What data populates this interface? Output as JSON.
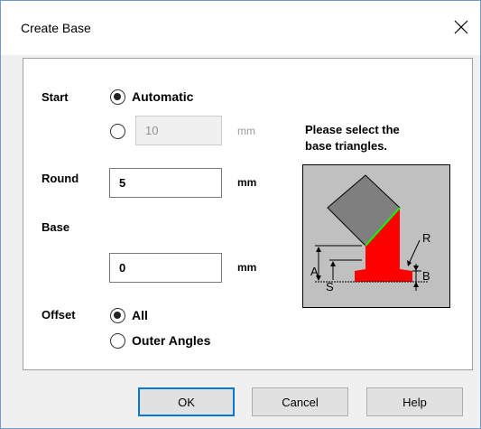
{
  "dialog": {
    "title": "Create Base"
  },
  "start": {
    "label": "Start",
    "option_automatic": "Automatic",
    "value": "10",
    "unit": "mm",
    "selected": "Automatic"
  },
  "round": {
    "label": "Round",
    "value": "5",
    "unit": "mm"
  },
  "base": {
    "label": "Base",
    "value": "0",
    "unit": "mm"
  },
  "offset": {
    "label": "Offset",
    "option_all": "All",
    "option_outer": "Outer Angles",
    "selected": "All"
  },
  "hint": {
    "line1": "Please select the",
    "line2": "base triangles."
  },
  "diagram": {
    "labels": {
      "r": "R",
      "a": "A",
      "b": "B",
      "s": "S"
    },
    "colors": {
      "bg": "#c0c0c0",
      "block": "#7f7f7f",
      "base": "#ff0000",
      "edge": "#00ff00"
    }
  },
  "buttons": {
    "ok": "OK",
    "cancel": "Cancel",
    "help": "Help"
  }
}
